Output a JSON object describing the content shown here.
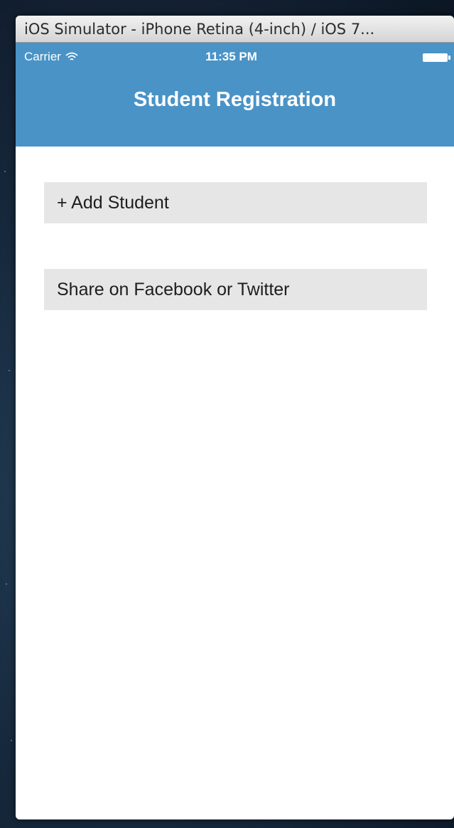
{
  "window": {
    "title": "iOS Simulator - iPhone Retina (4-inch) / iOS 7..."
  },
  "status_bar": {
    "carrier": "Carrier",
    "time": "11:35 PM",
    "icons": [
      "wifi-icon",
      "battery-icon"
    ]
  },
  "navigation": {
    "title": "Student Registration"
  },
  "actions": {
    "add_student": "+ Add Student",
    "share": "Share on Facebook or Twitter"
  },
  "colors": {
    "nav_bar": "#4a93c6",
    "row_background": "#e6e6e6",
    "text": "#1e1e1e"
  }
}
